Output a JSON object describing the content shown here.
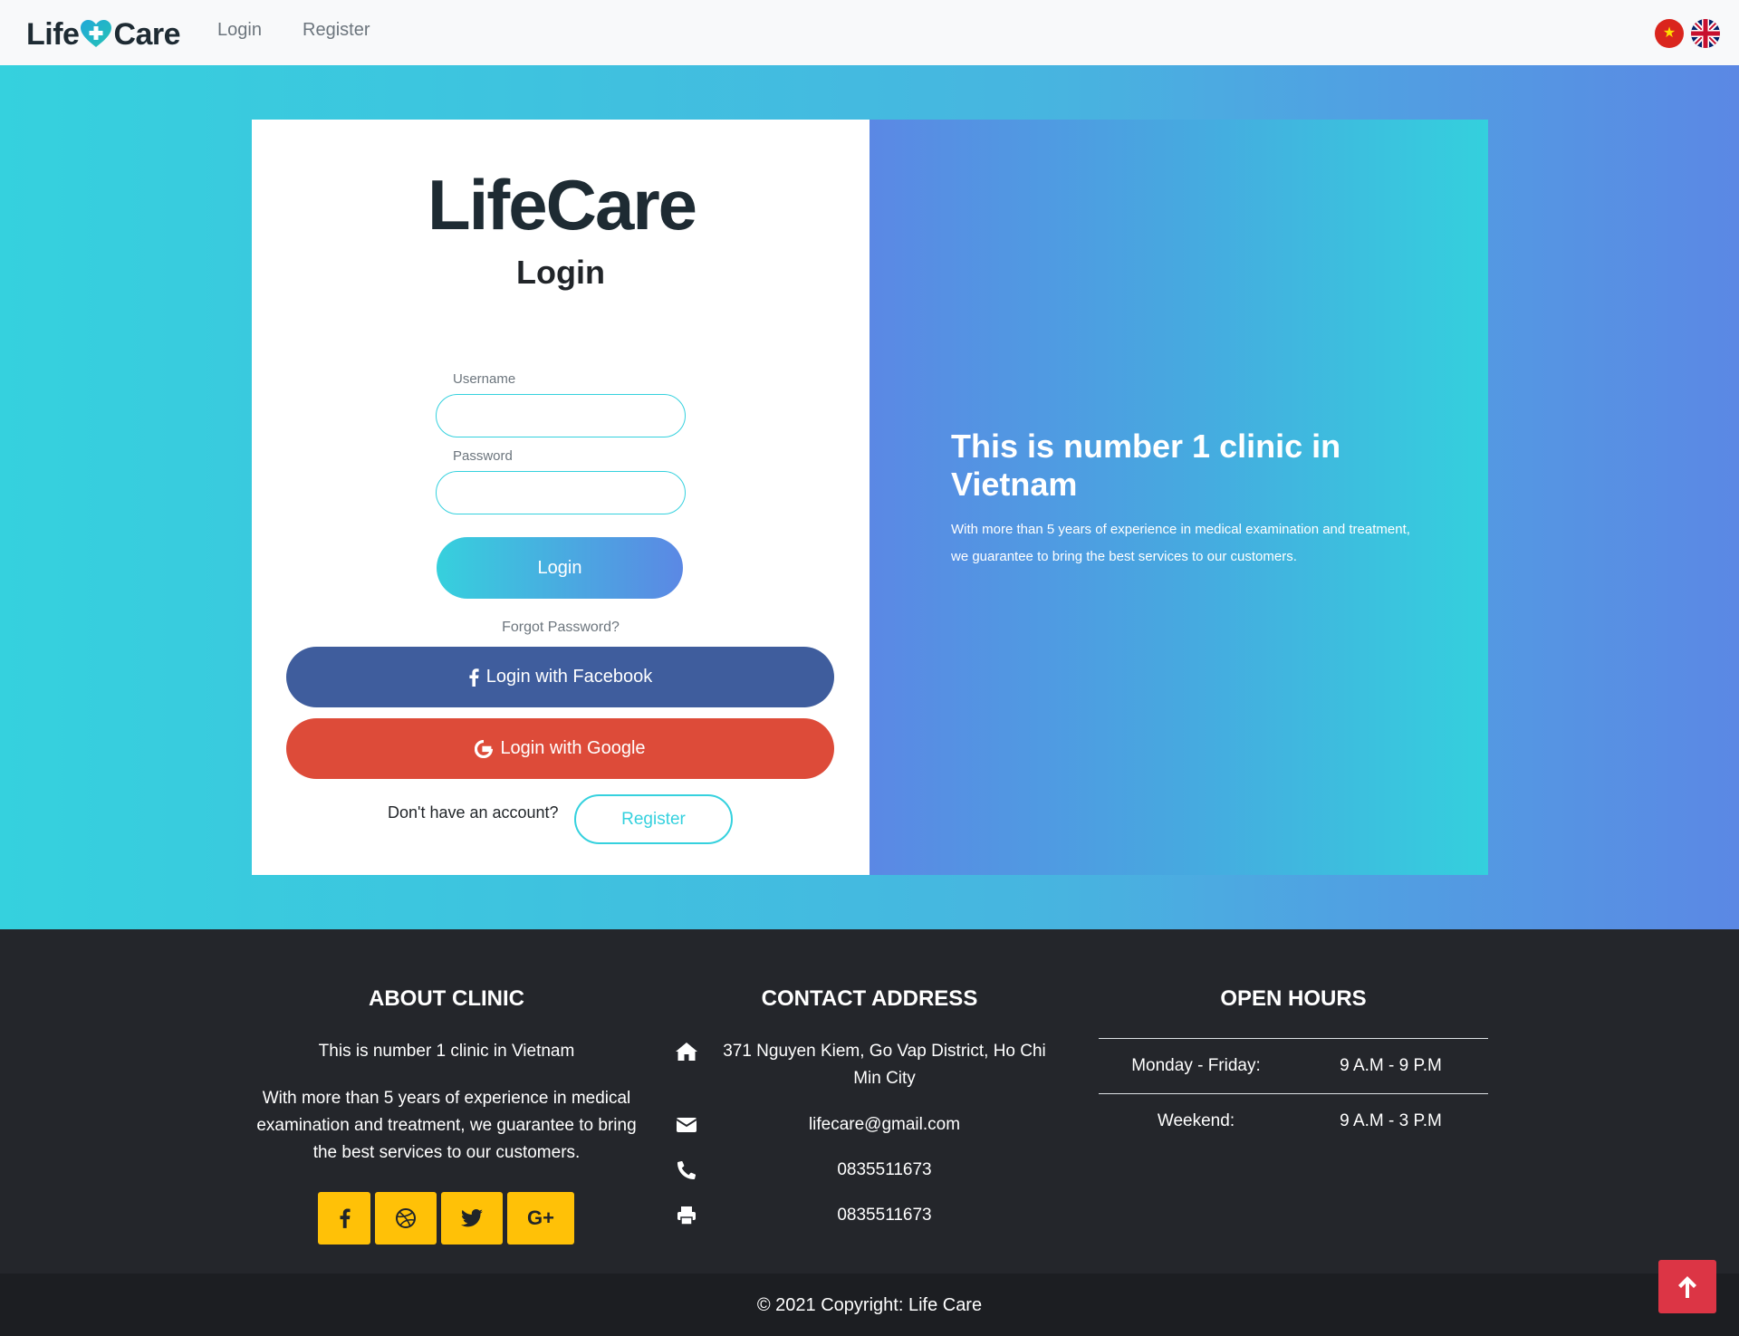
{
  "navbar": {
    "brand_left": "Life",
    "brand_right": "Care",
    "links": [
      "Login",
      "Register"
    ],
    "languages": [
      "vi-flag-icon",
      "uk-flag-icon"
    ]
  },
  "login": {
    "logo_left": "Life",
    "logo_right": "Care",
    "title": "Login",
    "username_label": "Username",
    "username_value": "",
    "password_label": "Password",
    "password_value": "",
    "submit_label": "Login",
    "forgot_label": "Forgot Password?",
    "facebook_label": "Login with Facebook",
    "google_label": "Login with Google",
    "no_account_text": "Don't have an account?",
    "register_label": "Register"
  },
  "hero": {
    "heading": "This is number 1 clinic in Vietnam",
    "description": "With more than 5 years of experience in medical examination and treatment, we guarantee to bring the best services to our customers."
  },
  "footer": {
    "about": {
      "title": "ABOUT CLINIC",
      "line1": "This is number 1 clinic in Vietnam",
      "description": "With more than 5 years of experience in medical examination and treatment, we guarantee to bring the best services to our customers.",
      "social": [
        "facebook-icon",
        "dribbble-icon",
        "twitter-icon",
        "google-plus-icon"
      ]
    },
    "contact": {
      "title": "CONTACT ADDRESS",
      "address": "371 Nguyen Kiem, Go Vap District, Ho Chi Min City",
      "email": "lifecare@gmail.com",
      "phone": "0835511673",
      "fax": "0835511673"
    },
    "hours": {
      "title": "OPEN HOURS",
      "rows": [
        {
          "day": "Monday - Friday:",
          "time": "9 A.M - 9 P.M"
        },
        {
          "day": "Weekend:",
          "time": "9 A.M - 3 P.M"
        }
      ]
    },
    "copyright": "© 2021 Copyright: Life Care"
  },
  "colors": {
    "accent": "#35d1de",
    "accent_end": "#5b88e4",
    "facebook": "#3f5d9d",
    "google": "#dd4b39",
    "social_square": "#ffc107",
    "back_to_top": "#dc3545",
    "footer_bg": "#24262b"
  }
}
